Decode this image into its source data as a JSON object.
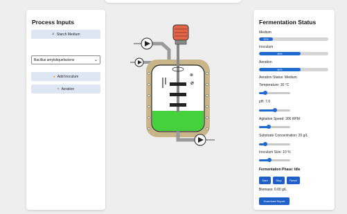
{
  "left": {
    "title": "Process Inputs",
    "starch_button": "Starch Medium",
    "strain_select": "Bacillus amyloliquefaciens",
    "inoculum_button": "Add Inoculum",
    "aeration_button": "Aeration"
  },
  "right": {
    "title": "Fermentation Status",
    "bars": [
      {
        "label": "Medium",
        "text": "20%",
        "value": 20
      },
      {
        "label": "Inoculum",
        "text": "60%",
        "value": 60
      },
      {
        "label": "Aeration",
        "text": "60%",
        "value": 60
      }
    ],
    "aeration_status": "Aeration Status: Medium",
    "sliders": [
      {
        "label": "Temperature: 30 °C",
        "value": 0.2
      },
      {
        "label": "pH: 7.0",
        "value": 0.5
      },
      {
        "label": "Agitation Speed: 300 RPM",
        "value": 0.3
      },
      {
        "label": "Substrate Concentration: 20 g/L",
        "value": 0.2
      },
      {
        "label": "Inoculum Size: 10 %",
        "value": 0.33
      }
    ],
    "phase": "Fermentation Phase: Idle",
    "start": "Start",
    "stop": "Stop",
    "reset": "Reset",
    "biomass": "Biomass: 0.00 g/L",
    "download": "Download Report"
  },
  "colors": {
    "accent": "#1e6ad1",
    "button_bg": "#dfe6f3",
    "liquid": "#44d13c",
    "motor": "#e0664a",
    "vessel_jacket": "#c8b58a"
  },
  "icons": [
    "wheat-icon",
    "bacteria-icon",
    "air-icon"
  ]
}
